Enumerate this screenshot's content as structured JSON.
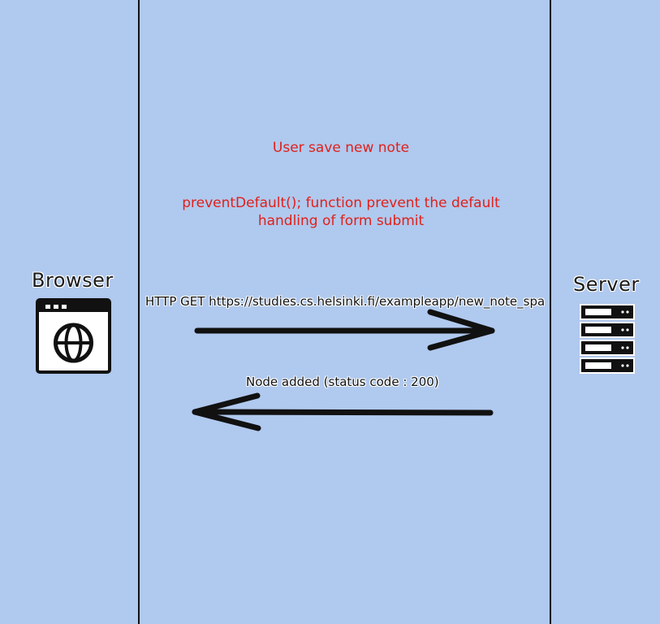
{
  "actors": {
    "browser": {
      "label": "Browser",
      "icon": "browser-window-globe-icon"
    },
    "server": {
      "label": "Server",
      "icon": "server-rack-icon"
    }
  },
  "notes": {
    "title": "User save new note",
    "body_line1": "preventDefault(); function prevent the default",
    "body_line2": "handling of form submit"
  },
  "messages": [
    {
      "from": "Browser",
      "to": "Server",
      "label": "HTTP GET https://studies.cs.helsinki.fi/exampleapp/new_note_spa"
    },
    {
      "from": "Server",
      "to": "Browser",
      "label": "Node added (status code : 200)"
    }
  ],
  "colors": {
    "background": "#b0c9ee",
    "note_text": "#e0201b",
    "line": "#111111"
  }
}
